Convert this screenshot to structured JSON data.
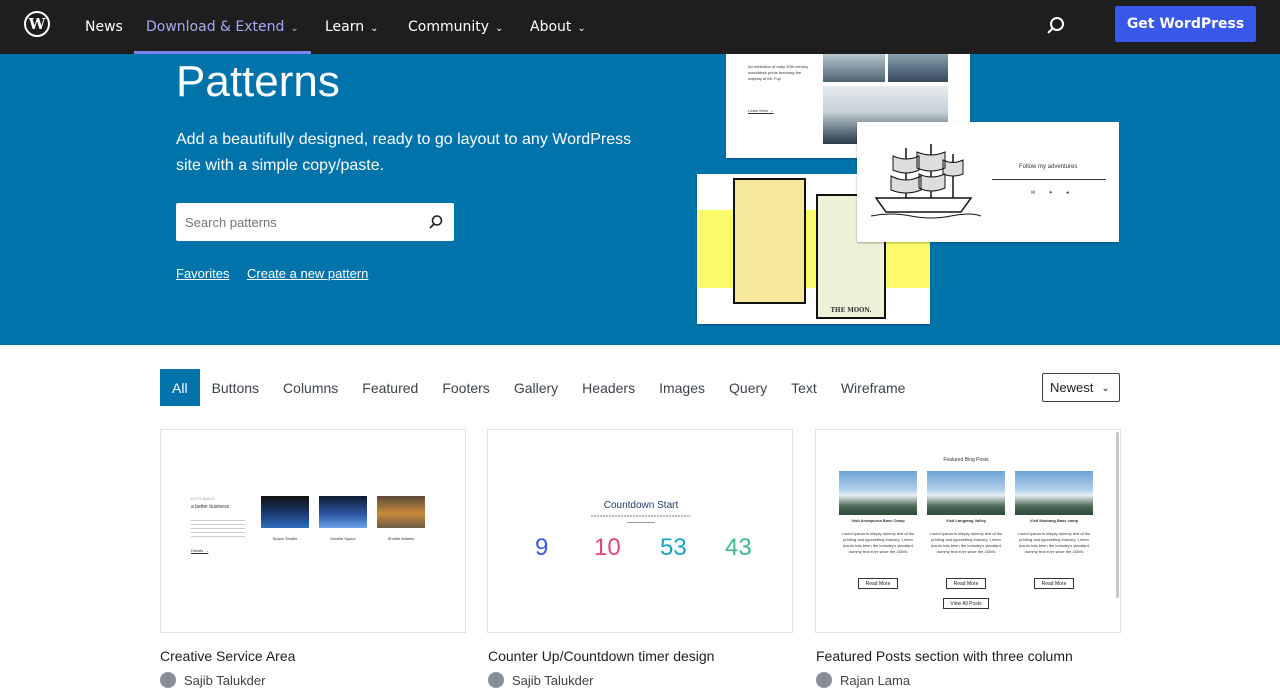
{
  "nav": {
    "items": [
      {
        "label": "News"
      },
      {
        "label": "Download & Extend"
      },
      {
        "label": "Learn"
      },
      {
        "label": "Community"
      },
      {
        "label": "About"
      }
    ],
    "cta_label": "Get WordPress",
    "logo_icon": "wordpress-logo-icon",
    "search_icon": "search-icon"
  },
  "hero": {
    "title": "Patterns",
    "description": "Add a beautifully designed, ready to go layout to any WordPress site with a simple copy/paste.",
    "search_placeholder": "Search patterns",
    "links": {
      "favorites": "Favorites",
      "create": "Create a new pattern"
    },
    "preview_a_text": "An exhibition of early 20th century woodblock prints featuring the majesty of Mt. Fuji.",
    "preview_a_link": "Learn More →",
    "preview_b_text": "Follow my adventures",
    "preview_c_card": "THE MOON."
  },
  "filters": {
    "categories": [
      "All",
      "Buttons",
      "Columns",
      "Featured",
      "Footers",
      "Gallery",
      "Headers",
      "Images",
      "Query",
      "Text",
      "Wireframe"
    ],
    "sort": "Newest"
  },
  "patterns": [
    {
      "title": "Creative Service Area",
      "author": "Sajib Talukder",
      "preview": {
        "heading_top": "LET'S BUILD",
        "heading": "a better business",
        "link": "Details →",
        "items": [
          "Space Shuttle",
          "Hubble Space",
          "Shuttle Atlantis"
        ]
      }
    },
    {
      "title": "Counter Up/Countdown timer design",
      "author": "Sajib Talukder",
      "preview": {
        "heading": "Countdown Start",
        "numbers": [
          "9",
          "10",
          "53",
          "43"
        ],
        "colors": [
          "#3858e9",
          "#e0457b",
          "#17a2c3",
          "#3fb98a"
        ]
      }
    },
    {
      "title": "Featured Posts section with three column",
      "author": "Rajan Lama",
      "preview": {
        "heading": "Featured Blog Posts",
        "posts": [
          "Visit Annapurna Base Camp",
          "Visit Langtang Valley",
          "Visit Mustang Base camp"
        ],
        "excerpt": "Lorem Ipsum is simply dummy text of the printing and typesetting industry. Lorem Ipsum has been the industry's standard dummy text ever since the 1500s",
        "read_more": "Read More",
        "view_all": "View All Posts"
      }
    }
  ]
}
